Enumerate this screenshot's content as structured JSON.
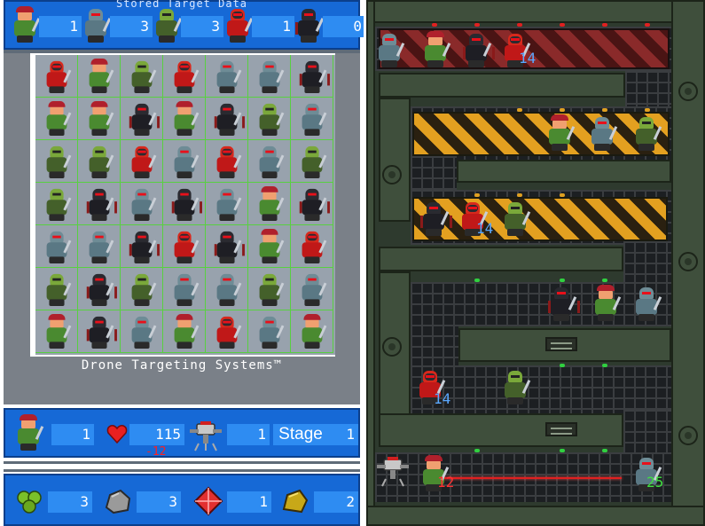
{
  "stored": {
    "title": "Stored Target Data",
    "targets": [
      {
        "type": "elf",
        "count": "1"
      },
      {
        "type": "knight",
        "count": "3"
      },
      {
        "type": "goblin",
        "count": "3"
      },
      {
        "type": "redmech",
        "count": "1"
      },
      {
        "type": "shadow",
        "count": "0"
      }
    ]
  },
  "grid": {
    "caption": "Drone Targeting Systems™",
    "rows": [
      [
        "redmech",
        "elf",
        "goblin",
        "redmech",
        "knight",
        "knight",
        "shadow"
      ],
      [
        "elf",
        "elf",
        "shadow",
        "elf",
        "shadow",
        "goblin",
        "knight"
      ],
      [
        "goblin",
        "goblin",
        "redmech",
        "knight",
        "redmech",
        "knight",
        "goblin"
      ],
      [
        "goblin",
        "shadow",
        "knight",
        "shadow",
        "knight",
        "elf",
        "shadow"
      ],
      [
        "knight",
        "knight",
        "shadow",
        "redmech",
        "shadow",
        "elf",
        "redmech"
      ],
      [
        "goblin",
        "shadow",
        "goblin",
        "knight",
        "knight",
        "goblin",
        "knight"
      ],
      [
        "elf",
        "shadow",
        "knight",
        "elf",
        "redmech",
        "knight",
        "elf"
      ]
    ]
  },
  "status": {
    "unit_count": "1",
    "health": "115",
    "health_delta": "-12",
    "drone_count": "1",
    "stage_label": "Stage",
    "stage_value": "1"
  },
  "resources": [
    {
      "icon": "green-gems-icon",
      "count": "3"
    },
    {
      "icon": "stone-icon",
      "count": "3"
    },
    {
      "icon": "red-crystal-icon",
      "count": "1"
    },
    {
      "icon": "gold-ore-icon",
      "count": "2"
    }
  ],
  "arena": {
    "damage_labels": [
      "14",
      "14",
      "14",
      "12",
      "25"
    ],
    "enemies": {
      "lane1": [
        "knight",
        "elf",
        "shadow",
        "redmech"
      ],
      "lane2": [
        "elf",
        "knight",
        "goblin"
      ],
      "lane3": [
        "shadow",
        "redmech",
        "goblin"
      ],
      "lane4": [
        "shadow",
        "elf",
        "knight"
      ],
      "lane5": [
        "redmech",
        "goblin"
      ],
      "lane6": [
        "drone",
        "elf",
        "knight"
      ]
    }
  },
  "colors": {
    "panel_blue": "#1669d6",
    "count_blue": "#2e8cf2",
    "grid_line": "#58d040",
    "damage_blue": "#5aa8ff",
    "damage_red": "#ff3030",
    "damage_green": "#40e040",
    "health_delta": "#ff2020"
  }
}
